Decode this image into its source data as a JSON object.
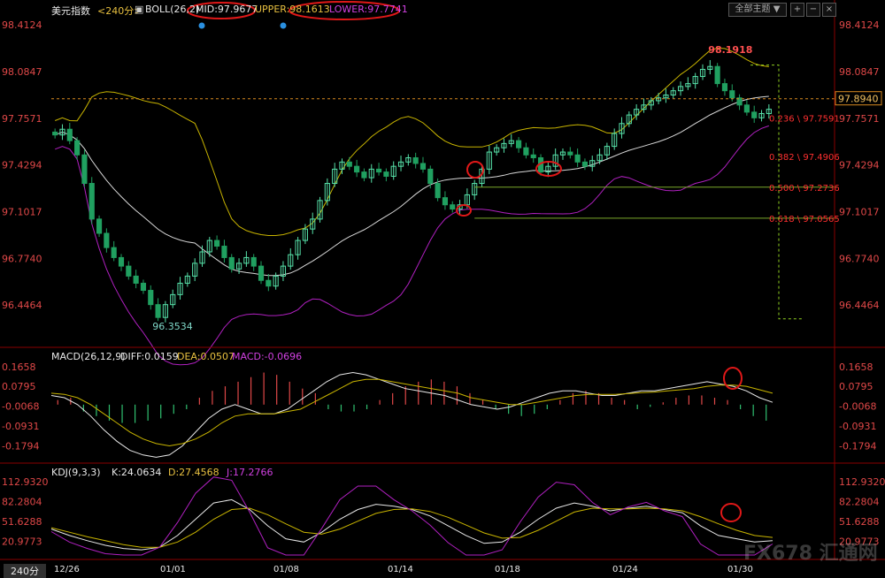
{
  "header": {
    "symbol": "美元指数",
    "period": "<240分>",
    "indicator": "BOLL(26,2)",
    "mid": "MID:97.9677",
    "upper": "UPPER:98.1613",
    "lower": "LOWER:97.7741",
    "theme_button": "全部主题",
    "theme_arrow": "▼"
  },
  "macd_header": {
    "name": "MACD(26,12,9)",
    "diff": "DIFF:0.0159",
    "dea": "DEA:0.0507",
    "macd": "MACD:-0.0696"
  },
  "kdj_header": {
    "name": "KDJ(9,3,3)",
    "k": "K:24.0634",
    "d": "D:27.4568",
    "j": "J:17.2766"
  },
  "footer": {
    "period_label": "240分",
    "watermark": "FX678 汇通网"
  },
  "colors": {
    "up": "#56e0a8",
    "down": "#20a060",
    "mid": "#d8d8d8",
    "upper": "#c8b400",
    "lower": "#b020c0",
    "axis_label": "#e04848",
    "fib": "#7aa82a"
  },
  "chart_data": [
    {
      "type": "candlestick",
      "title": "美元指数 BOLL(26,2)",
      "ylim": [
        96.2,
        98.45
      ],
      "y_ticks": [
        "98.4124",
        "98.0847",
        "97.7571",
        "97.4294",
        "97.1017",
        "96.7740",
        "96.4464"
      ],
      "x_ticks": [
        "12/26",
        "01/01",
        "01/08",
        "01/14",
        "01/18",
        "01/24",
        "01/30"
      ],
      "current_price": "97.8940",
      "high_label": "98.1918",
      "low_label": "96.3534",
      "fib_levels": [
        "0.236 \\ 97.7591",
        "0.382 \\ 97.4906",
        "0.500 \\ 97.2736",
        "0.618 \\ 97.0565"
      ],
      "closes": [
        97.64,
        97.68,
        97.6,
        97.5,
        97.3,
        97.05,
        96.95,
        96.85,
        96.78,
        96.72,
        96.65,
        96.6,
        96.55,
        96.45,
        96.36,
        96.45,
        96.52,
        96.6,
        96.65,
        96.74,
        96.82,
        96.9,
        96.86,
        96.78,
        96.7,
        96.74,
        96.78,
        96.72,
        96.62,
        96.58,
        96.65,
        96.72,
        96.8,
        96.9,
        96.98,
        97.05,
        97.18,
        97.3,
        97.4,
        97.45,
        97.42,
        97.38,
        97.34,
        97.4,
        97.38,
        97.35,
        97.42,
        97.45,
        97.48,
        97.44,
        97.4,
        97.3,
        97.2,
        97.15,
        97.12,
        97.15,
        97.22,
        97.3,
        97.4,
        97.52,
        97.55,
        97.58,
        97.6,
        97.55,
        97.5,
        97.48,
        97.38,
        97.42,
        97.5,
        97.52,
        97.5,
        97.45,
        97.42,
        97.46,
        97.5,
        97.56,
        97.65,
        97.72,
        97.78,
        97.82,
        97.85,
        97.88,
        97.9,
        97.92,
        97.95,
        97.98,
        98.0,
        98.05,
        98.1,
        98.12,
        98.0,
        97.95,
        97.9,
        97.85,
        97.8,
        97.76,
        97.79,
        97.82
      ]
    },
    {
      "type": "line",
      "title": "MACD(26,12,9)",
      "y_ticks": [
        "0.1658",
        "0.0795",
        "-0.0068",
        "-0.0931",
        "-0.1794"
      ],
      "ylim": [
        -0.24,
        0.2
      ],
      "series": [
        {
          "name": "DIFF",
          "values": [
            0.04,
            0.03,
            0.0,
            -0.05,
            -0.11,
            -0.16,
            -0.2,
            -0.22,
            -0.23,
            -0.22,
            -0.18,
            -0.12,
            -0.06,
            -0.02,
            0.0,
            -0.02,
            -0.04,
            -0.04,
            -0.02,
            0.02,
            0.06,
            0.1,
            0.13,
            0.14,
            0.13,
            0.11,
            0.09,
            0.07,
            0.06,
            0.05,
            0.04,
            0.02,
            0.0,
            -0.01,
            -0.02,
            -0.01,
            0.01,
            0.03,
            0.05,
            0.06,
            0.06,
            0.05,
            0.04,
            0.04,
            0.05,
            0.06,
            0.06,
            0.07,
            0.08,
            0.09,
            0.1,
            0.09,
            0.08,
            0.06,
            0.03,
            0.01
          ]
        },
        {
          "name": "DEA",
          "values": [
            0.05,
            0.045,
            0.03,
            0.0,
            -0.04,
            -0.08,
            -0.12,
            -0.15,
            -0.17,
            -0.18,
            -0.17,
            -0.15,
            -0.12,
            -0.08,
            -0.05,
            -0.04,
            -0.04,
            -0.04,
            -0.03,
            -0.02,
            0.01,
            0.04,
            0.07,
            0.1,
            0.11,
            0.11,
            0.1,
            0.09,
            0.08,
            0.07,
            0.06,
            0.05,
            0.03,
            0.02,
            0.01,
            0.0,
            0.0,
            0.01,
            0.02,
            0.03,
            0.04,
            0.045,
            0.045,
            0.045,
            0.048,
            0.052,
            0.055,
            0.06,
            0.065,
            0.07,
            0.08,
            0.085,
            0.085,
            0.08,
            0.065,
            0.05
          ]
        }
      ],
      "histogram": [
        0.02,
        0.03,
        -0.03,
        -0.05,
        -0.07,
        -0.08,
        -0.08,
        -0.07,
        -0.06,
        -0.04,
        -0.02,
        0.03,
        0.06,
        0.08,
        0.1,
        0.12,
        0.14,
        0.13,
        0.1,
        0.07,
        0.05,
        -0.02,
        -0.03,
        -0.03,
        -0.02,
        0.02,
        0.05,
        0.08,
        0.1,
        0.11,
        0.1,
        0.08,
        0.05,
        0.02,
        -0.02,
        -0.04,
        -0.05,
        -0.04,
        -0.02,
        0.02,
        0.05,
        0.06,
        0.05,
        0.03,
        0.02,
        -0.02,
        -0.01,
        0.01,
        0.03,
        0.04,
        0.04,
        0.03,
        0.02,
        -0.02,
        -0.05,
        -0.07
      ]
    },
    {
      "type": "line",
      "title": "KDJ(9,3,3)",
      "y_ticks": [
        "112.9320",
        "82.2804",
        "51.6288",
        "20.9773"
      ],
      "ylim": [
        0,
        125
      ],
      "series": [
        {
          "name": "K",
          "values": [
            40,
            30,
            22,
            15,
            10,
            8,
            12,
            30,
            55,
            80,
            85,
            70,
            45,
            25,
            20,
            35,
            55,
            70,
            78,
            75,
            70,
            60,
            45,
            30,
            18,
            20,
            35,
            55,
            72,
            80,
            75,
            68,
            72,
            75,
            70,
            65,
            45,
            30,
            25,
            20,
            22
          ]
        },
        {
          "name": "D",
          "values": [
            42,
            35,
            28,
            22,
            16,
            12,
            12,
            20,
            35,
            55,
            70,
            72,
            62,
            48,
            35,
            32,
            40,
            52,
            64,
            70,
            71,
            67,
            58,
            46,
            34,
            26,
            27,
            38,
            52,
            66,
            72,
            71,
            71,
            72,
            71,
            68,
            59,
            48,
            38,
            30,
            27
          ]
        },
        {
          "name": "J",
          "values": [
            36,
            20,
            10,
            2,
            -2,
            0,
            12,
            50,
            95,
            120,
            115,
            66,
            11,
            -21,
            -10,
            41,
            85,
            106,
            106,
            85,
            68,
            46,
            19,
            -2,
            -14,
            8,
            51,
            89,
            112,
            108,
            81,
            62,
            74,
            81,
            68,
            59,
            17,
            -6,
            -1,
            0,
            17
          ]
        }
      ]
    }
  ]
}
